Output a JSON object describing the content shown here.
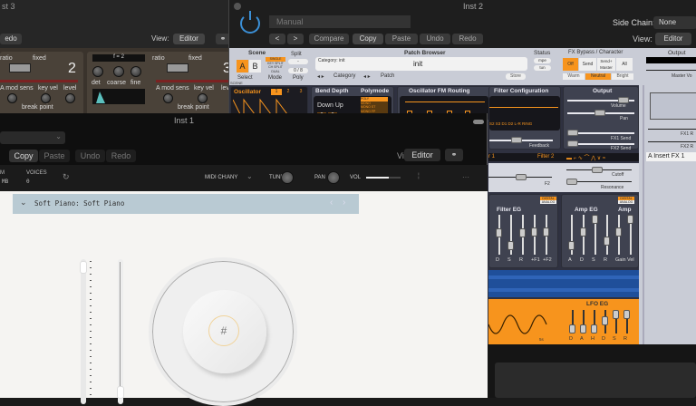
{
  "inst3": {
    "title": "st 3",
    "redo": "edo",
    "view_label": "View:",
    "view_value": "Editor",
    "op1": {
      "ratio": "ratio",
      "fixed": "fixed",
      "number": "2",
      "amod": "A mod sens",
      "keyvel": "key vel",
      "level": "level",
      "breakpoint": "break point"
    },
    "op2": {
      "display": "f = 2",
      "ratio": "ratio",
      "fixed": "fixed",
      "number": "3",
      "det": "det",
      "coarse": "coarse",
      "fine": "fine",
      "amod": "A mod sens",
      "keyvel": "key vel",
      "level": "lev",
      "breakpoint": "break point"
    }
  },
  "inst2": {
    "title": "Inst 2",
    "preset": "Manual",
    "buttons": {
      "prev": "<",
      "next": ">",
      "compare": "Compare",
      "copy": "Copy",
      "paste": "Paste",
      "undo": "Undo",
      "redo": "Redo"
    },
    "side_chain_label": "Side Chain:",
    "side_chain_value": "None",
    "view_label": "View:",
    "view_value": "Editor",
    "synth": {
      "scene": {
        "title": "Scene",
        "a": "A",
        "b": "B",
        "select": "Select",
        "modes": [
          "SINGLE",
          "KEY SPLIT",
          "CH SPLIT",
          "DUAL"
        ],
        "mode_label": "Mode",
        "split": "Split",
        "split_value": "-",
        "poly_value": "0 / 8",
        "poly": "Poly",
        "section": "SCENE"
      },
      "patch_browser": {
        "title": "Patch Browser",
        "category": "Category: init",
        "name": "init",
        "category_label": "Category",
        "patch_label": "Patch",
        "store": "Store"
      },
      "status": {
        "title": "Status",
        "mpe": "mpe",
        "tun": "tun"
      },
      "fx": {
        "title": "FX Bypass / Character",
        "off": "Off",
        "send": "Send",
        "send_master": "Send+ Master",
        "all": "All",
        "warm": "Warm",
        "neutral": "Neutral",
        "bright": "Bright"
      },
      "output_top": {
        "title": "Output",
        "master": "Master Vo"
      },
      "oscillator": {
        "title": "Oscillator",
        "tabs": [
          "1",
          "2",
          "3"
        ]
      },
      "bend": {
        "title": "Bend Depth",
        "down_up": "Down Up",
        "down": "2",
        "up": "2"
      },
      "polymode": {
        "title": "Polymode",
        "options": [
          "POLY",
          "MONO",
          "MONO ST",
          "MONO FP",
          "MONO ST+FP"
        ]
      },
      "fm_routing": {
        "title": "Oscillator FM Routing"
      },
      "filter_config": {
        "title": "Filter Configuration",
        "routes": "S2 S3 D1 D2 L-R RING",
        "feedback": "Feedback"
      },
      "output": {
        "title": "Output",
        "volume": "Volume",
        "pan": "Pan",
        "fx1": "FX1 Send",
        "fx2": "FX2 Send"
      },
      "filter_bar": {
        "f1": "r 1",
        "f2": "Filter 2"
      },
      "filter_ctrl": {
        "f2": "F2",
        "cutoff": "Cutoff",
        "resonance": "Resonance"
      },
      "filter_eg": {
        "title": "Filter EG",
        "badge1": "DIGITAL",
        "badge2": "ANALOG",
        "labels": [
          "D",
          "S",
          "R",
          "+F1",
          "+F2"
        ],
        "levels": [
          0.55,
          0.15,
          0.55,
          0.6,
          0.6
        ]
      },
      "amp_eg": {
        "title": "Amp EG",
        "amp": "Amp",
        "badge1": "DIGITAL",
        "badge2": "ANALOG",
        "labels": [
          "A",
          "D",
          "S",
          "R",
          "Gain",
          "Vel"
        ],
        "levels": [
          0.15,
          0.6,
          1.0,
          0.3,
          0.6,
          1.0
        ]
      },
      "lfo_eg": {
        "title": "LFO EG",
        "labels": [
          "D",
          "A",
          "H",
          "D",
          "S",
          "R"
        ],
        "levels": [
          0.0,
          0.0,
          0.0,
          0.55,
          1.0,
          1.0
        ],
        "rate": "5s"
      },
      "fx_side": {
        "fx1": "FX1 R",
        "fx2": "FX2 R",
        "insert": "A Insert FX 1"
      },
      "colors": {
        "orange": "#f7941d",
        "blue": "#1f4f9a",
        "panel": "#3f4250",
        "bg": "#c9ccd6"
      }
    }
  },
  "inst1": {
    "title": "Inst 1",
    "buttons": {
      "copy": "Copy",
      "paste": "Paste",
      "undo": "Undo",
      "redo": "Redo"
    },
    "view_label": "View:",
    "view_value": "Editor",
    "mem_label": "M",
    "mem_value": "MB",
    "voices_label": "VOICES",
    "voices_value": "0",
    "midi_label": "MIDI CH:",
    "midi_value": "ANY",
    "tune": "TUNE",
    "pan": "PAN",
    "vol": "VOL",
    "vol_level": 0.65,
    "more": "···",
    "preset": "Soft Piano: Soft Piano"
  }
}
